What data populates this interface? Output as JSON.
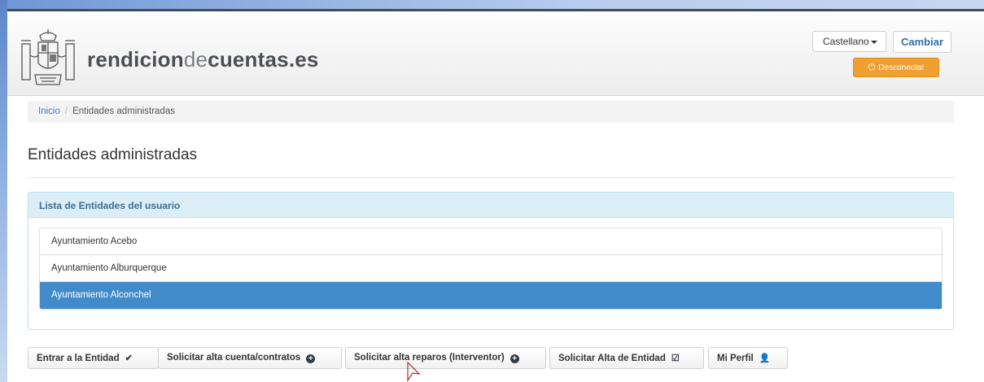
{
  "header": {
    "brand_bold_1": "rendicion",
    "brand_light": "de",
    "brand_bold_2": "cuentas.es",
    "language_selected": "Castellano",
    "change_label": "Cambiar",
    "logout_label": "Desconectar"
  },
  "breadcrumb": {
    "home": "Inicio",
    "separator": "/",
    "current": "Entidades administradas"
  },
  "page": {
    "title": "Entidades administradas"
  },
  "panel": {
    "heading": "Lista de Entidades del usuario",
    "items": [
      {
        "label": "Ayuntamiento Acebo",
        "active": false
      },
      {
        "label": "Ayuntamiento Alburquerque",
        "active": false
      },
      {
        "label": "Ayuntamiento Alconchel",
        "active": true
      }
    ]
  },
  "actions": [
    {
      "label": "Entrar a la Entidad",
      "icon": "check-icon"
    },
    {
      "label": "Solicitar alta cuenta/contratos",
      "icon": "plus-circle-icon"
    },
    {
      "label": "Solicitar alta reparos (Interventor)",
      "icon": "plus-circle-icon"
    },
    {
      "label": "Solicitar Alta de Entidad",
      "icon": "edit-check-icon"
    },
    {
      "label": "Mi Perfil",
      "icon": "user-icon"
    }
  ],
  "colors": {
    "accent": "#428bca",
    "logout": "#f0a030",
    "panel_heading_bg": "#dbeef8",
    "link": "#3f7fc2"
  }
}
